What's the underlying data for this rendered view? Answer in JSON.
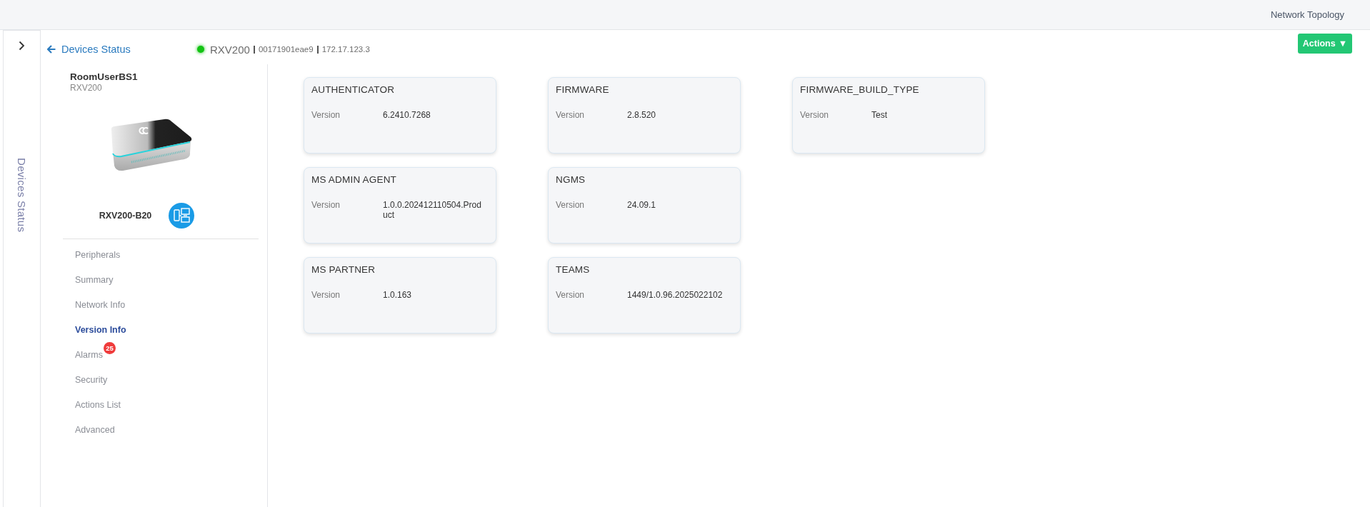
{
  "top_bar": {
    "link": "Network Topology"
  },
  "side_rail": {
    "label": "Devices Status"
  },
  "header": {
    "back_link": "Devices Status",
    "device": {
      "online": true,
      "name": "RXV200",
      "mac": "00171901eae9",
      "ip": "172.17.123.3"
    },
    "actions": {
      "label": "Actions",
      "caret": "▼"
    }
  },
  "device_panel": {
    "name": "RoomUserBS1",
    "model": "RXV200",
    "variant": "RXV200-B20"
  },
  "nav": [
    {
      "label": "Peripherals",
      "selected": false
    },
    {
      "label": "Summary",
      "selected": false
    },
    {
      "label": "Network Info",
      "selected": false
    },
    {
      "label": "Version Info",
      "selected": true
    },
    {
      "label": "Alarms",
      "selected": false,
      "badge": "25"
    },
    {
      "label": "Security",
      "selected": false
    },
    {
      "label": "Actions List",
      "selected": false
    },
    {
      "label": "Advanced",
      "selected": false
    }
  ],
  "cards": [
    {
      "title": "AUTHENTICATOR",
      "rows": [
        {
          "label": "Version",
          "value": "6.2410.7268"
        }
      ]
    },
    {
      "title": "MS ADMIN AGENT",
      "rows": [
        {
          "label": "Version",
          "value": "1.0.0.202412110504.Product"
        }
      ]
    },
    {
      "title": "MS PARTNER",
      "rows": [
        {
          "label": "Version",
          "value": "1.0.163"
        }
      ]
    },
    {
      "title": "FIRMWARE",
      "rows": [
        {
          "label": "Version",
          "value": "2.8.520"
        }
      ]
    },
    {
      "title": "NGMS",
      "rows": [
        {
          "label": "Version",
          "value": "24.09.1"
        }
      ]
    },
    {
      "title": "TEAMS",
      "rows": [
        {
          "label": "Version",
          "value": "1449/1.0.96.2025022102"
        }
      ]
    },
    {
      "title": "FIRMWARE_BUILD_TYPE",
      "rows": [
        {
          "label": "Version",
          "value": "Test"
        }
      ]
    }
  ]
}
